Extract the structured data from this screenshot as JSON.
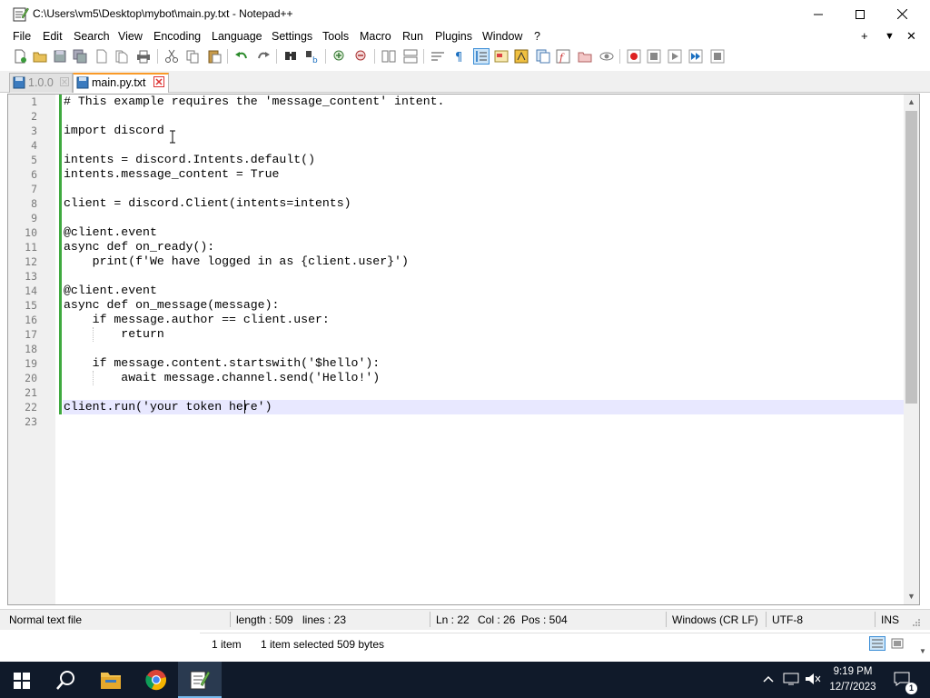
{
  "window": {
    "title": "C:\\Users\\vm5\\Desktop\\mybot\\main.py.txt - Notepad++",
    "minimize_glyph": "—",
    "maximize_glyph": "☐",
    "close_glyph": "✕"
  },
  "menu": {
    "items": [
      "File",
      "Edit",
      "Search",
      "View",
      "Encoding",
      "Language",
      "Settings",
      "Tools",
      "Macro",
      "Run",
      "Plugins",
      "Window",
      "?"
    ],
    "right": {
      "plus": "+",
      "down": "▼",
      "close": "✕"
    }
  },
  "tabs": [
    {
      "label": "1.0.0",
      "active": false
    },
    {
      "label": "main.py.txt",
      "active": true,
      "close_glyph": "✕"
    }
  ],
  "editor": {
    "lines": [
      "# This example requires the 'message_content' intent.",
      "",
      "import discord",
      "",
      "intents = discord.Intents.default()",
      "intents.message_content = True",
      "",
      "client = discord.Client(intents=intents)",
      "",
      "@client.event",
      "async def on_ready():",
      "    print(f'We have logged in as {client.user}')",
      "",
      "@client.event",
      "async def on_message(message):",
      "    if message.author == client.user:",
      "        return",
      "",
      "    if message.content.startswith('$hello'):",
      "        await message.channel.send('Hello!')",
      "",
      "client.run('your token here')",
      ""
    ],
    "current_line": 22,
    "cursor_col": 26
  },
  "statusbar": {
    "file_type": "Normal text file",
    "length": "length : 509",
    "lines": "lines : 23",
    "ln": "Ln : 22",
    "col": "Col : 26",
    "pos": "Pos : 504",
    "eol": "Windows (CR LF)",
    "encoding": "UTF-8",
    "mode": "INS"
  },
  "explorer_status": {
    "count": "1 item",
    "selected": "1 item selected",
    "size": "509 bytes"
  },
  "taskbar": {
    "time": "9:19 PM",
    "date": "12/7/2023",
    "notification_count": "1"
  },
  "colors": {
    "accent": "#fa9a28",
    "change_bar": "#3fa93f",
    "current_line": "#e8e8ff",
    "taskbar": "#101a2a"
  }
}
